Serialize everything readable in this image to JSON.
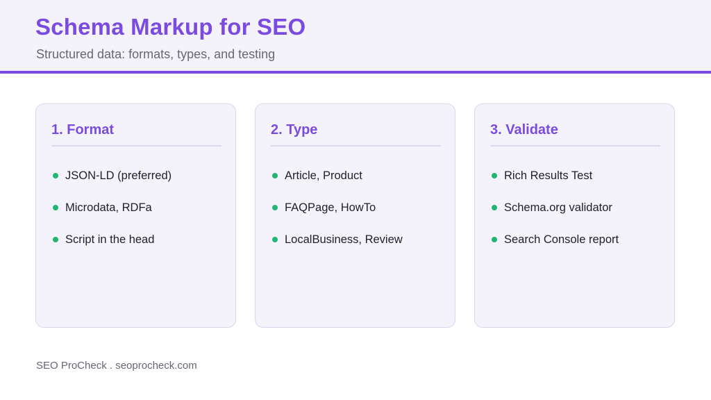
{
  "header": {
    "title": "Schema Markup for SEO",
    "subtitle": "Structured data: formats, types, and testing"
  },
  "cards": [
    {
      "title": "1. Format",
      "items": [
        "JSON-LD (preferred)",
        "Microdata, RDFa",
        "Script in the head"
      ]
    },
    {
      "title": "2. Type",
      "items": [
        "Article, Product",
        "FAQPage, HowTo",
        "LocalBusiness, Review"
      ]
    },
    {
      "title": "3. Validate",
      "items": [
        "Rich Results Test",
        "Schema.org validator",
        "Search Console report"
      ]
    }
  ],
  "footer": {
    "text": "SEO ProCheck . seoprocheck.com"
  },
  "colors": {
    "accent": "#7b4be0",
    "bullet": "#22b573",
    "panel": "#f4f3fb"
  }
}
